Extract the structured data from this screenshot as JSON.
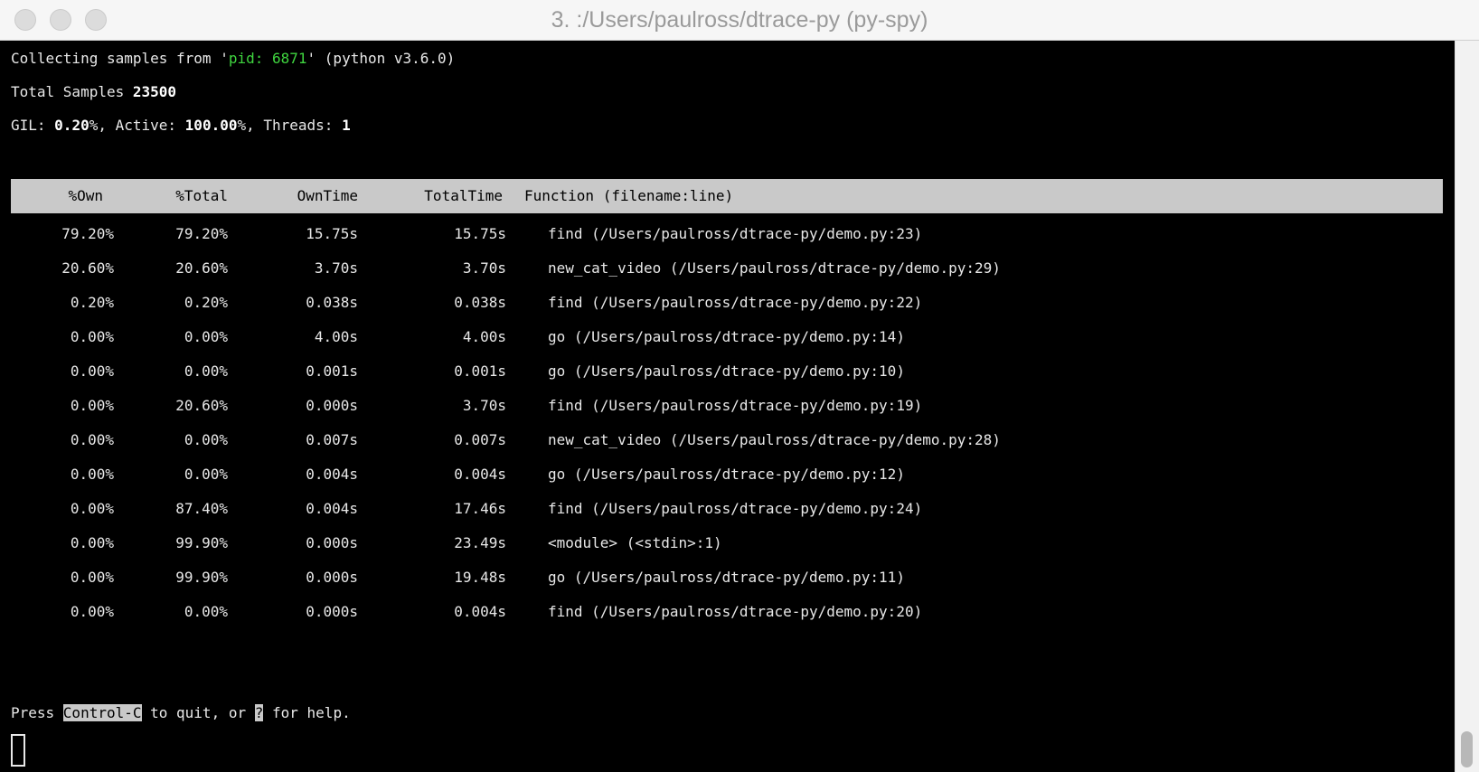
{
  "window": {
    "title": "3. :/Users/paulross/dtrace-py (py-spy)"
  },
  "status": {
    "line1_prefix": "Collecting samples from '",
    "pid": "pid: 6871",
    "line1_suffix": "' (python v3.6.0)",
    "samples_label": "Total Samples ",
    "samples_value": "23500",
    "gil_label": "GIL: ",
    "gil_value": "0.20",
    "active_label": "%, Active: ",
    "active_value": "100.00",
    "threads_label": "%, Threads: ",
    "threads_value": "1"
  },
  "table": {
    "columns": [
      "%Own",
      "%Total",
      "OwnTime",
      "TotalTime",
      "Function (filename:line)"
    ],
    "rows": [
      [
        "79.20%",
        "79.20%",
        "15.75s",
        "15.75s",
        "find (/Users/paulross/dtrace-py/demo.py:23)"
      ],
      [
        "20.60%",
        "20.60%",
        "3.70s",
        "3.70s",
        "new_cat_video (/Users/paulross/dtrace-py/demo.py:29)"
      ],
      [
        "0.20%",
        "0.20%",
        "0.038s",
        "0.038s",
        "find (/Users/paulross/dtrace-py/demo.py:22)"
      ],
      [
        "0.00%",
        "0.00%",
        "4.00s",
        "4.00s",
        "go (/Users/paulross/dtrace-py/demo.py:14)"
      ],
      [
        "0.00%",
        "0.00%",
        "0.001s",
        "0.001s",
        "go (/Users/paulross/dtrace-py/demo.py:10)"
      ],
      [
        "0.00%",
        "20.60%",
        "0.000s",
        "3.70s",
        "find (/Users/paulross/dtrace-py/demo.py:19)"
      ],
      [
        "0.00%",
        "0.00%",
        "0.007s",
        "0.007s",
        "new_cat_video (/Users/paulross/dtrace-py/demo.py:28)"
      ],
      [
        "0.00%",
        "0.00%",
        "0.004s",
        "0.004s",
        "go (/Users/paulross/dtrace-py/demo.py:12)"
      ],
      [
        "0.00%",
        "87.40%",
        "0.004s",
        "17.46s",
        "find (/Users/paulross/dtrace-py/demo.py:24)"
      ],
      [
        "0.00%",
        "99.90%",
        "0.000s",
        "23.49s",
        "<module> (<stdin>:1)"
      ],
      [
        "0.00%",
        "99.90%",
        "0.000s",
        "19.48s",
        "go (/Users/paulross/dtrace-py/demo.py:11)"
      ],
      [
        "0.00%",
        "0.00%",
        "0.000s",
        "0.004s",
        "find (/Users/paulross/dtrace-py/demo.py:20)"
      ]
    ]
  },
  "footer": {
    "press": "Press ",
    "key_quit": "Control-C",
    "middle": " to quit, or ",
    "key_help": "?",
    "end": " for help."
  },
  "colors": {
    "terminal_bg": "#000000",
    "text": "#e8e8e8",
    "pid_green": "#3fd43f",
    "header_bg": "#c9c9c9"
  }
}
